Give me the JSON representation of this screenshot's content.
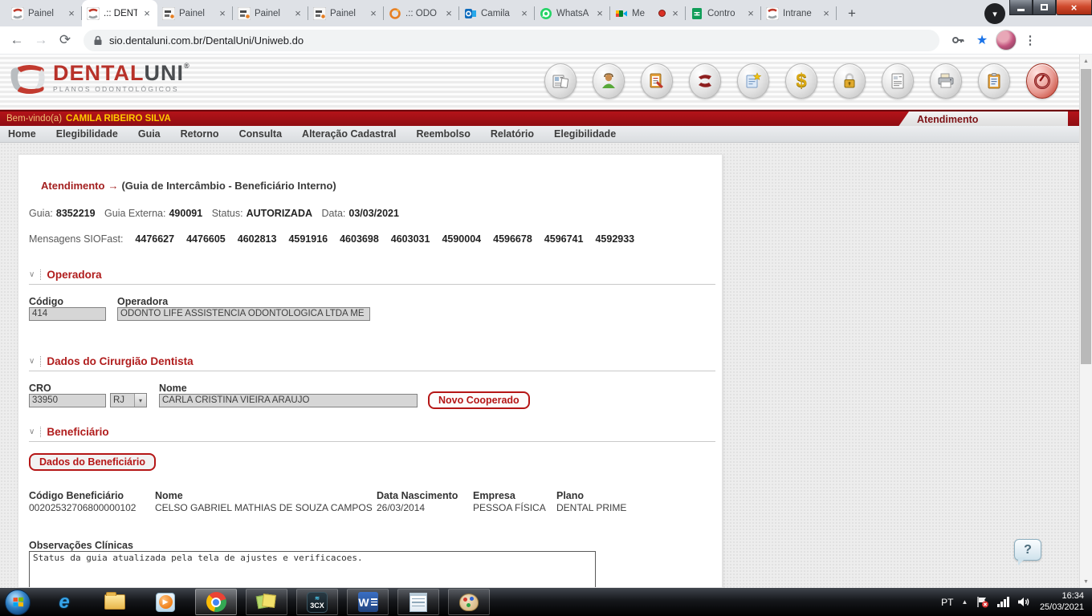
{
  "glyphs": {
    "close": "×",
    "plus": "+",
    "back": "←",
    "forward": "→",
    "reload": "⟳",
    "menu": "⋮",
    "star": "★",
    "chevron": "∨",
    "caret_down": "▾",
    "tri_up": "▲",
    "tri_down": "▼",
    "dollar": "$",
    "arrow": "→",
    "play": "�} "
  },
  "browser": {
    "tabs": [
      {
        "title": "Painel"
      },
      {
        "title": ".:: DENT"
      },
      {
        "title": "Painel"
      },
      {
        "title": "Painel"
      },
      {
        "title": "Painel"
      },
      {
        "title": ".:: ODO"
      },
      {
        "title": "Camila"
      },
      {
        "title": "WhatsA"
      },
      {
        "title": "Me"
      },
      {
        "title": "Contro"
      },
      {
        "title": "Intrane"
      }
    ],
    "url": "sio.dentaluni.com.br/DentalUni/Uniweb.do"
  },
  "app": {
    "logo": {
      "part1": "DENTAL",
      "part2": "UNI",
      "reg": "®",
      "tagline": "PLANOS ODONTOLÓGICOS"
    },
    "welcome_prefix": "Bem-vindo(a)",
    "welcome_user": "CAMILA RIBEIRO SILVA",
    "active_module": "Atendimento",
    "nav": [
      "Home",
      "Elegibilidade",
      "Guia",
      "Retorno",
      "Consulta",
      "Alteração Cadastral",
      "Reembolso",
      "Relatório",
      "Elegibilidade"
    ]
  },
  "content": {
    "breadcrumb": {
      "section": "Atendimento",
      "detail": "(Guia de Intercâmbio - Beneficiário Interno)"
    },
    "guia": {
      "guia_label": "Guia:",
      "guia_value": "8352219",
      "externa_label": "Guia Externa:",
      "externa_value": "490091",
      "status_label": "Status:",
      "status_value": "AUTORIZADA",
      "data_label": "Data:",
      "data_value": "03/03/2021"
    },
    "mensagens": {
      "label": "Mensagens SIOFast:",
      "values": [
        "4476627",
        "4476605",
        "4602813",
        "4591916",
        "4603698",
        "4603031",
        "4590004",
        "4596678",
        "4596741",
        "4592933"
      ]
    },
    "operadora": {
      "title": "Operadora",
      "codigo_label": "Código",
      "codigo_value": "414",
      "operadora_label": "Operadora",
      "operadora_value": "ODONTO LIFE ASSISTENCIA ODONTOLOGICA LTDA ME"
    },
    "dentista": {
      "title": "Dados do Cirurgião Dentista",
      "cro_label": "CRO",
      "cro_value": "33950",
      "uf_value": "RJ",
      "nome_label": "Nome",
      "nome_value": "CARLA CRISTINA VIEIRA ARAUJO",
      "novo_cooperado_button": "Novo Cooperado"
    },
    "beneficiario": {
      "title": "Beneficiário",
      "dados_button": "Dados do Beneficiário",
      "columns": [
        {
          "label": "Código Beneficiário",
          "value": "00202532706800000102"
        },
        {
          "label": "Nome",
          "value": "CELSO GABRIEL MATHIAS DE SOUZA CAMPOS"
        },
        {
          "label": "Data Nascimento",
          "value": "26/03/2014"
        },
        {
          "label": "Empresa",
          "value": "PESSOA FÍSICA"
        },
        {
          "label": "Plano",
          "value": "DENTAL PRIME"
        }
      ]
    },
    "observacoes": {
      "label": "Observações Clínicas",
      "value": "Status da guia atualizada pela tela de ajustes e verificacoes."
    },
    "help": "?"
  },
  "system": {
    "tray_lang": "PT",
    "tray_time": "16:34",
    "tray_date": "25/03/2021",
    "threecx_label": "3CX",
    "word_label": "W"
  }
}
